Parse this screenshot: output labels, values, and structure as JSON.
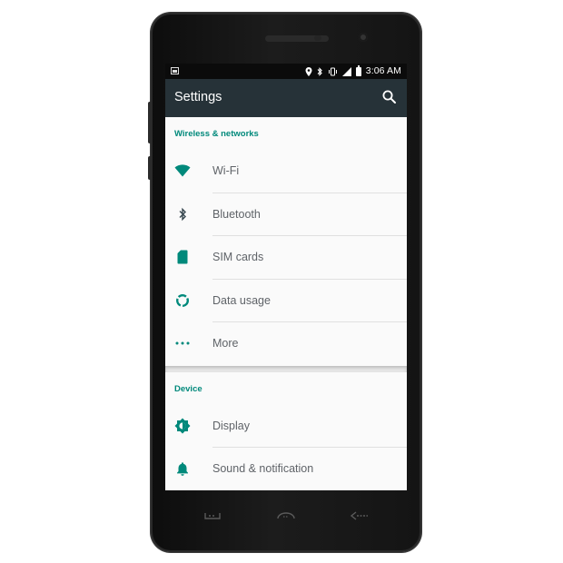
{
  "colors": {
    "accent": "#00897b",
    "appbar": "#263238",
    "statusbar": "#0b0b0b",
    "list_text": "#5f6368"
  },
  "statusbar": {
    "icons": [
      "image-icon",
      "location-icon",
      "bluetooth-icon",
      "vibrate-icon",
      "signal-icon",
      "battery-icon"
    ],
    "time": "3:06 AM"
  },
  "appbar": {
    "title": "Settings",
    "search_icon": "search-icon"
  },
  "sections": [
    {
      "header": "Wireless & networks",
      "items": [
        {
          "label": "Wi-Fi",
          "icon": "wifi-icon"
        },
        {
          "label": "Bluetooth",
          "icon": "bluetooth-icon"
        },
        {
          "label": "SIM cards",
          "icon": "sim-card-icon"
        },
        {
          "label": "Data usage",
          "icon": "data-usage-icon"
        },
        {
          "label": "More",
          "icon": "more-icon"
        }
      ]
    },
    {
      "header": "Device",
      "items": [
        {
          "label": "Display",
          "icon": "brightness-icon"
        },
        {
          "label": "Sound & notification",
          "icon": "bell-icon"
        }
      ]
    }
  ],
  "navbar": {
    "keys": [
      "menu-key-icon",
      "home-key-icon",
      "back-key-icon"
    ]
  }
}
